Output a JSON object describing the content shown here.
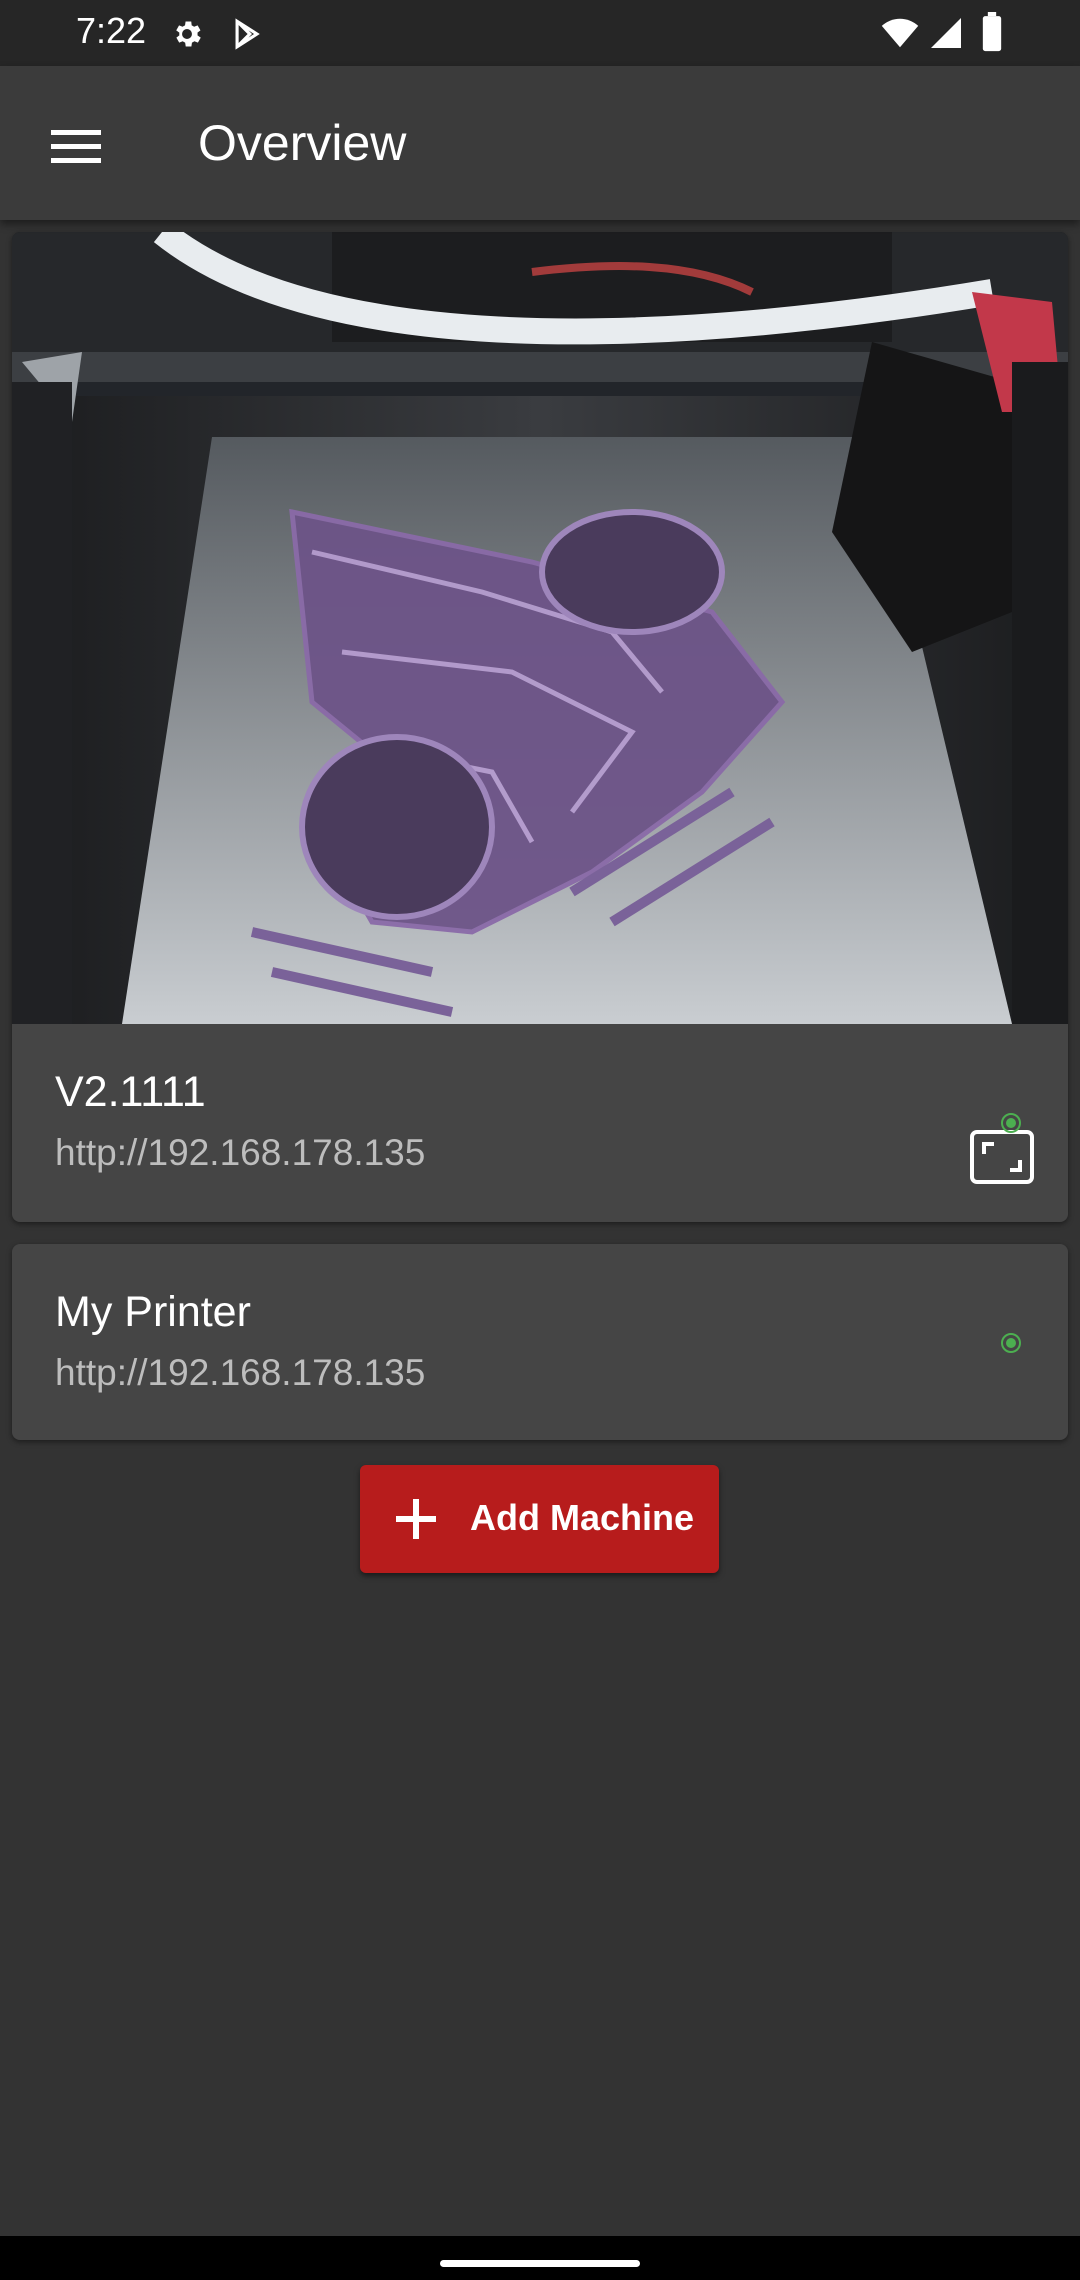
{
  "status_bar": {
    "time": "7:22",
    "icons": [
      "gear-icon",
      "play-store-icon",
      "wifi-icon",
      "signal-icon",
      "battery-icon"
    ]
  },
  "app_bar": {
    "title": "Overview",
    "menu_icon": "menu-icon"
  },
  "machines": [
    {
      "name": "V2.1111",
      "url": "http://192.168.178.135",
      "status_color": "#4caf50",
      "has_webcam": true
    },
    {
      "name": "My Printer",
      "url": "http://192.168.178.135",
      "status_color": "#4caf50",
      "has_webcam": false
    }
  ],
  "add_button": {
    "label": "Add Machine",
    "icon": "plus-icon"
  },
  "colors": {
    "background": "#333333",
    "card": "#454545",
    "accent": "#b71c1c",
    "online": "#4caf50"
  }
}
